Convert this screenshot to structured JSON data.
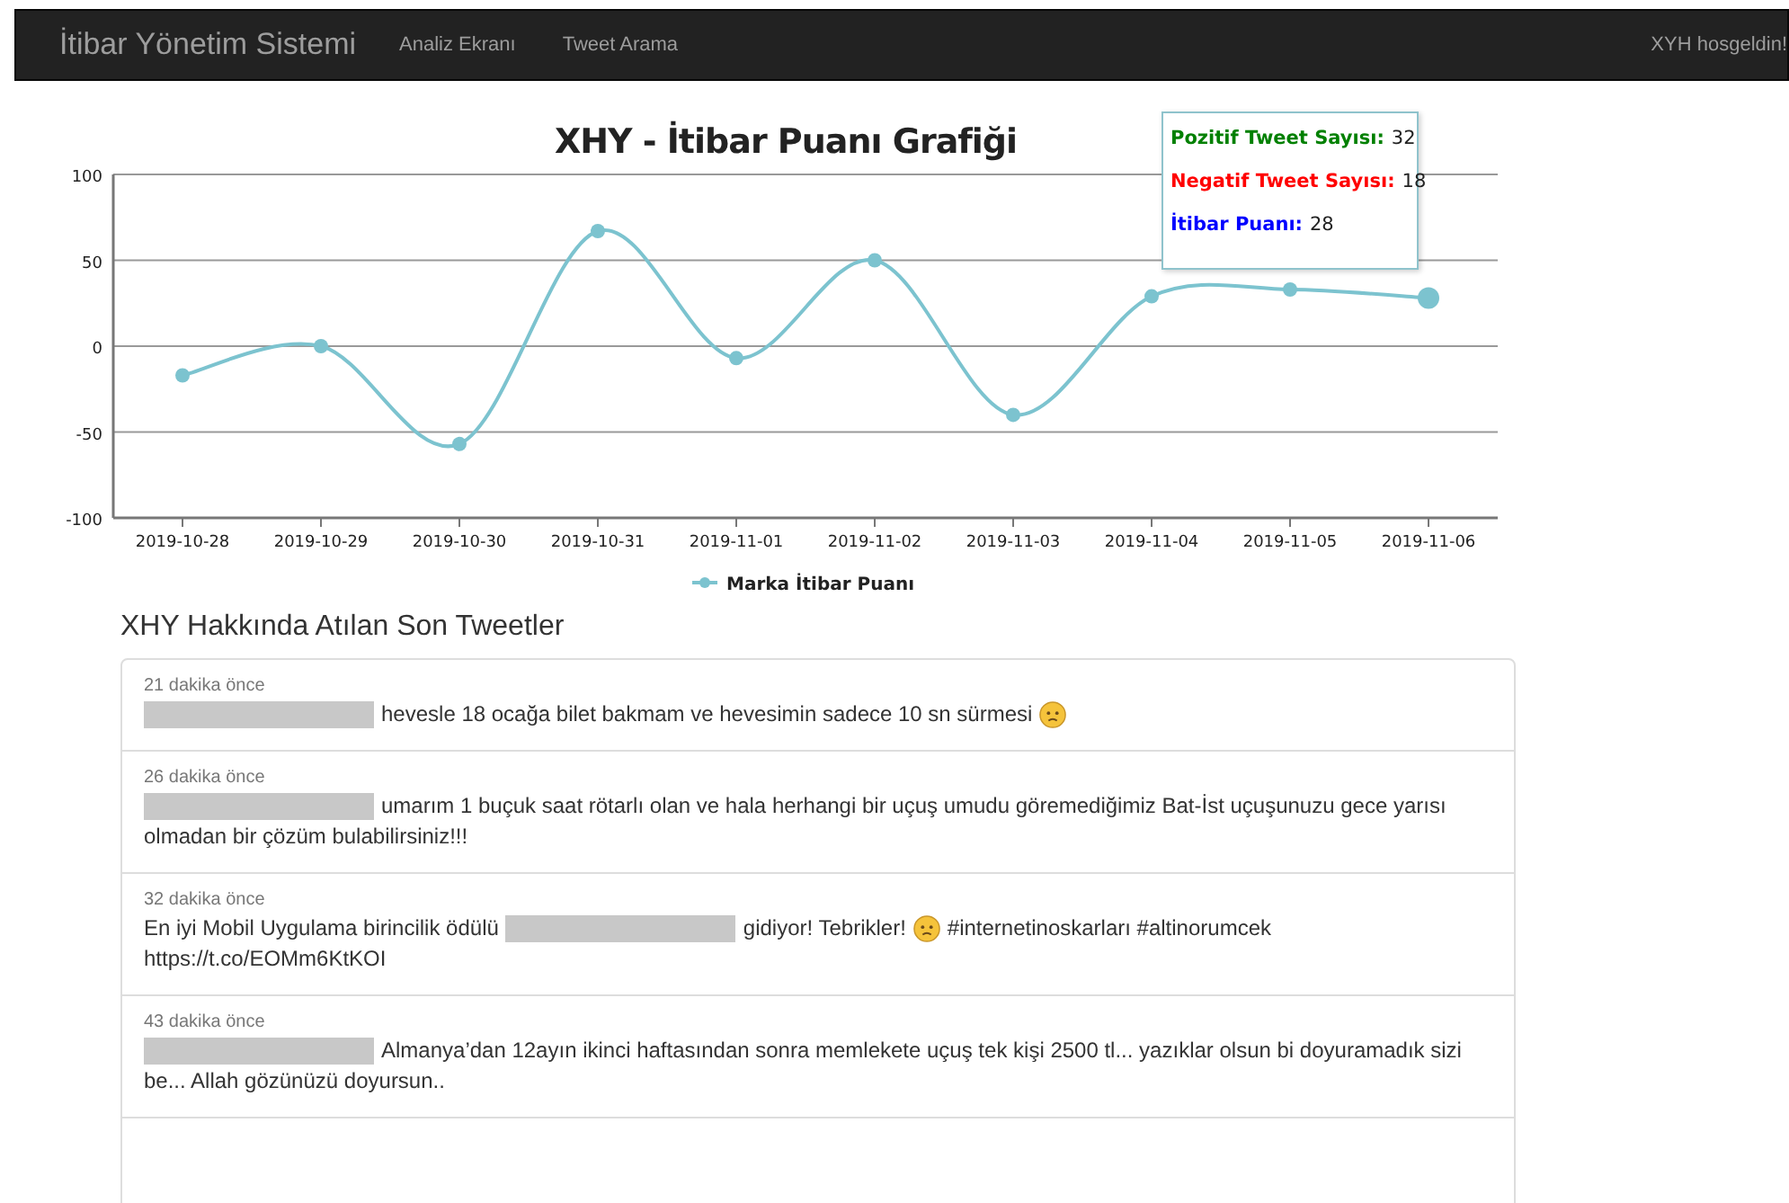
{
  "navbar": {
    "brand": "İtibar Yönetim Sistemi",
    "links": [
      {
        "label": "Analiz Ekranı"
      },
      {
        "label": "Tweet Arama"
      }
    ],
    "greeting": "XYH hosgeldin!"
  },
  "chart": {
    "chart_data": {
      "type": "line",
      "title": "XHY - İtibar Puanı Grafiği",
      "grid": true,
      "categories": [
        "2019-10-28",
        "2019-10-29",
        "2019-10-30",
        "2019-10-31",
        "2019-11-01",
        "2019-11-02",
        "2019-11-03",
        "2019-11-04",
        "2019-11-05",
        "2019-11-06"
      ],
      "series": [
        {
          "name": "Marka İtibar Puanı",
          "color": "#7cc3cf",
          "marker": true,
          "values": [
            -17,
            0,
            -57,
            67,
            -7,
            50,
            -40,
            29,
            33,
            28
          ]
        }
      ],
      "ylim": [
        -100,
        100
      ],
      "yticks": [
        -100,
        -50,
        0,
        50,
        100
      ]
    },
    "tooltip": {
      "rows": [
        {
          "label": "Pozitif Tweet Sayısı:",
          "value": "32",
          "color": "#008000"
        },
        {
          "label": "Negatif Tweet Sayısı:",
          "value": "18",
          "color": "#ff0000"
        },
        {
          "label": "İtibar Puanı:",
          "value": "28",
          "color": "#0000ff"
        }
      ]
    }
  },
  "tweets_heading": "XHY Hakkında Atılan Son Tweetler",
  "tweets": [
    {
      "time": "21 dakika önce",
      "parts": [
        {
          "kind": "redacted"
        },
        {
          "kind": "text",
          "text": "hevesle 18 ocağa bilet bakmam ve hevesimin sadece 10 sn sürmesi"
        },
        {
          "kind": "emoji"
        }
      ]
    },
    {
      "time": "26 dakika önce",
      "parts": [
        {
          "kind": "redacted"
        },
        {
          "kind": "text",
          "text": "umarım 1 buçuk saat rötarlı olan ve hala herhangi bir uçuş umudu göremediğimiz Bat-İst uçuşunuzu gece yarısı"
        },
        {
          "kind": "text",
          "text": "olmadan bir çözüm bulabilirsiniz!!!"
        }
      ]
    },
    {
      "time": "32 dakika önce",
      "parts": [
        {
          "kind": "text",
          "text": "En iyi Mobil Uygulama birincilik ödülü"
        },
        {
          "kind": "redacted"
        },
        {
          "kind": "text",
          "text": "gidiyor! Tebrikler!"
        },
        {
          "kind": "emoji"
        },
        {
          "kind": "text",
          "text": "#internetinoskarları #altinorumcek"
        },
        {
          "kind": "text",
          "text": "https://t.co/EOMm6KtKOI"
        }
      ]
    },
    {
      "time": "43 dakika önce",
      "parts": [
        {
          "kind": "redacted"
        },
        {
          "kind": "text",
          "text": "Almanya’dan 12ayın ikinci haftasından sonra memlekete uçuş tek kişi 2500 tl... yazıklar olsun bi doyuramadık sizi"
        },
        {
          "kind": "text",
          "text": "be... Allah gözünüzü doyursun.."
        }
      ]
    }
  ]
}
